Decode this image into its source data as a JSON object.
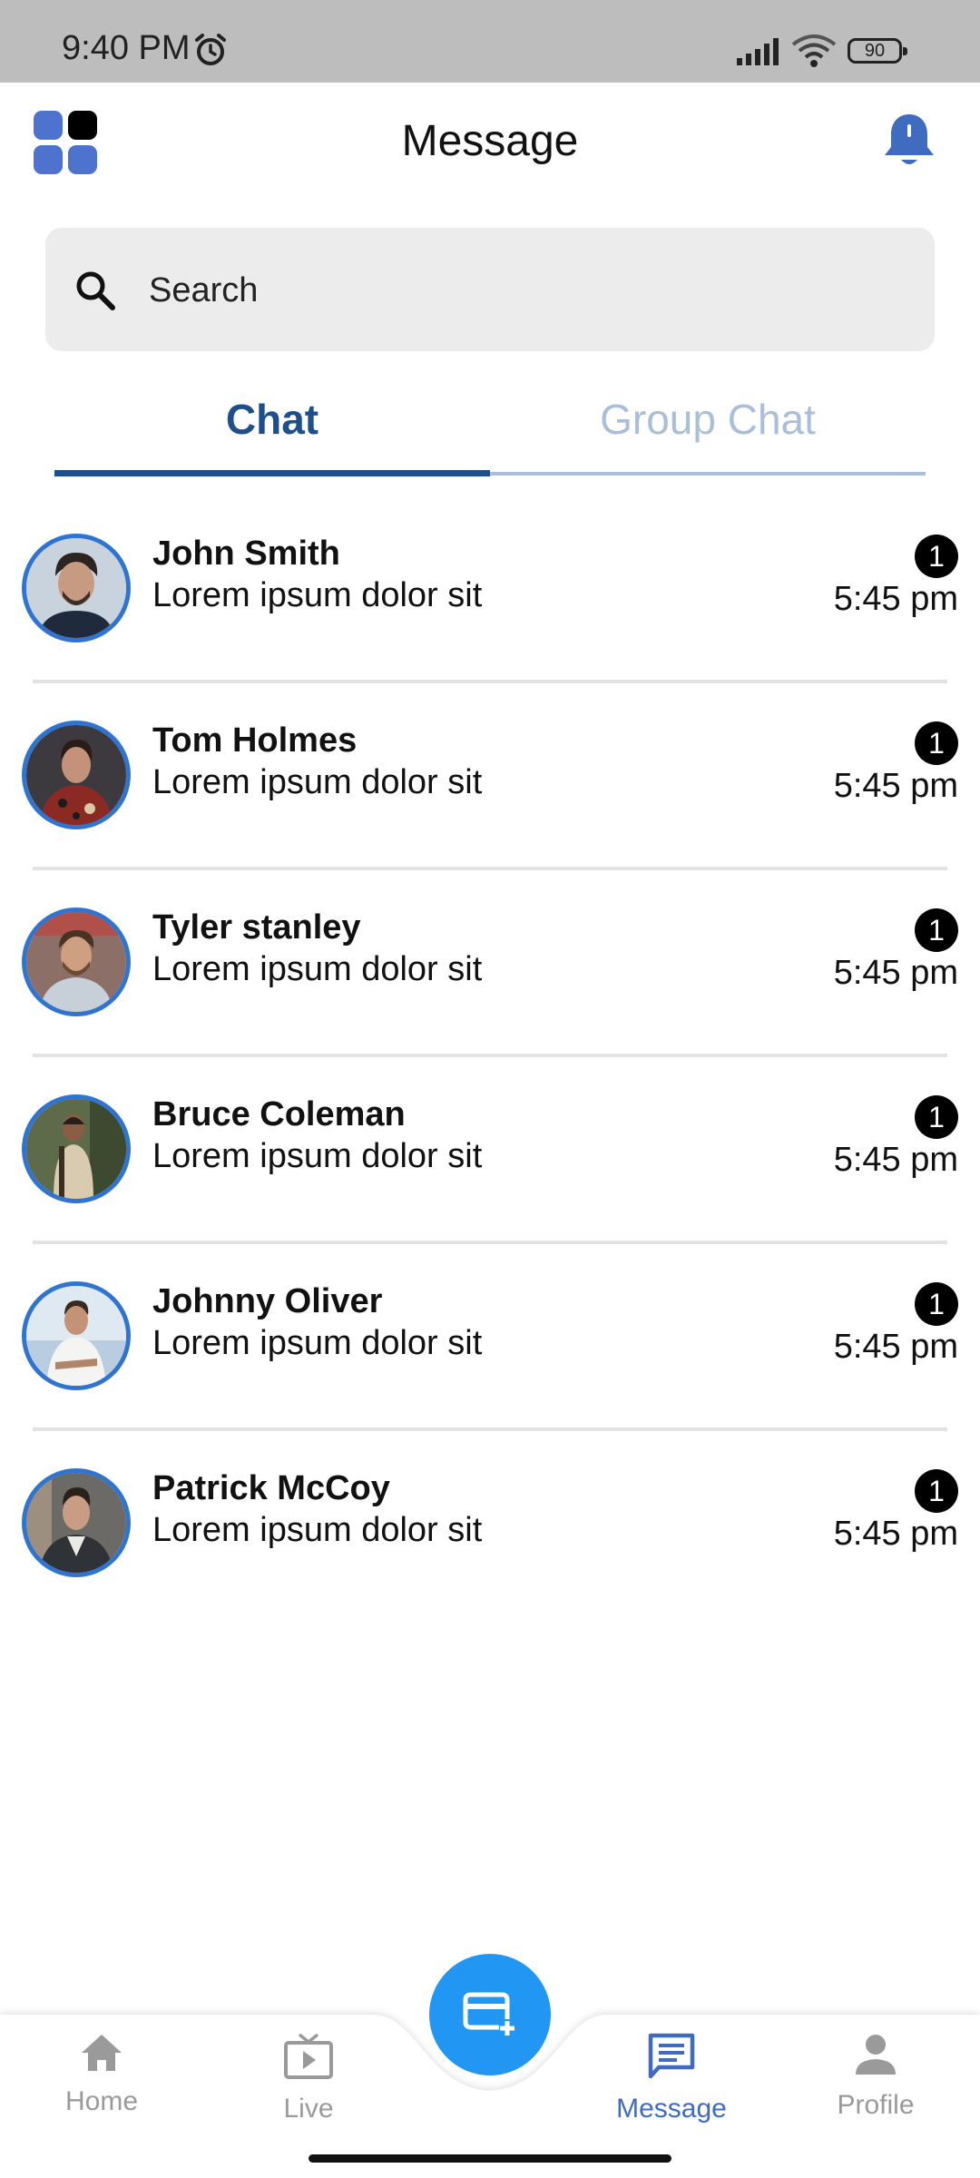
{
  "status_bar": {
    "time": "9:40 PM",
    "battery": "90"
  },
  "header": {
    "title": "Message"
  },
  "search": {
    "placeholder": "Search"
  },
  "tabs": [
    {
      "label": "Chat",
      "active": true
    },
    {
      "label": "Group Chat",
      "active": false
    }
  ],
  "chats": [
    {
      "name": "John Smith",
      "message": "Lorem ipsum dolor sit",
      "time": "5:45 pm",
      "unread": "1"
    },
    {
      "name": "Tom Holmes",
      "message": "Lorem ipsum dolor sit",
      "time": "5:45 pm",
      "unread": "1"
    },
    {
      "name": "Tyler stanley",
      "message": "Lorem ipsum dolor sit",
      "time": "5:45 pm",
      "unread": "1"
    },
    {
      "name": "Bruce Coleman",
      "message": "Lorem ipsum dolor sit",
      "time": "5:45 pm",
      "unread": "1"
    },
    {
      "name": "Johnny Oliver",
      "message": "Lorem ipsum dolor sit",
      "time": "5:45 pm",
      "unread": "1"
    },
    {
      "name": "Patrick McCoy",
      "message": "Lorem ipsum dolor sit",
      "time": "5:45 pm",
      "unread": "1"
    }
  ],
  "bottom_nav": {
    "items": [
      {
        "label": "Home",
        "icon": "home-icon"
      },
      {
        "label": "Live",
        "icon": "tv-icon"
      },
      {
        "label": "Message",
        "icon": "message-icon",
        "active": true
      },
      {
        "label": "Profile",
        "icon": "person-icon"
      }
    ],
    "fab_icon": "new-card-icon"
  },
  "colors": {
    "primary_dark": "#1c4f8c",
    "tab_inactive": "#a9bfd9",
    "avatar_ring": "#2f74d0",
    "fab": "#2196f3",
    "nav_active": "#3f6cbf",
    "bell": "#3f6cbf"
  }
}
